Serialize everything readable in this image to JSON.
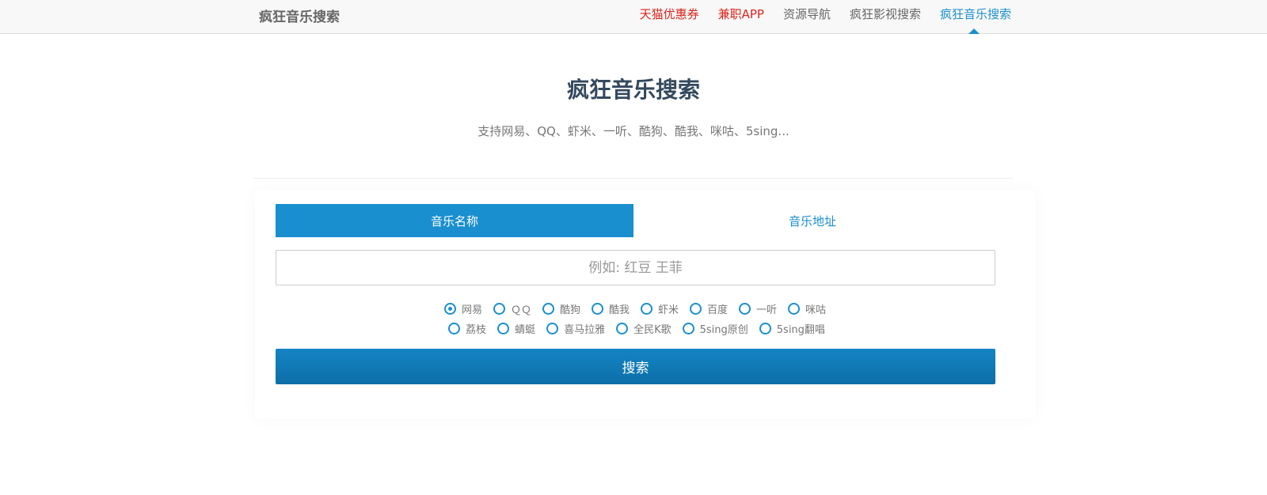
{
  "navbar": {
    "brand": "疯狂音乐搜索",
    "links": [
      {
        "label": "天猫优惠券",
        "state": "highlight"
      },
      {
        "label": "兼职APP",
        "state": "highlight"
      },
      {
        "label": "资源导航",
        "state": "normal"
      },
      {
        "label": "疯狂影视搜索",
        "state": "normal"
      },
      {
        "label": "疯狂音乐搜索",
        "state": "active"
      }
    ]
  },
  "hero": {
    "title": "疯狂音乐搜索",
    "subtitle": "支持网易、QQ、虾米、一听、酷狗、酷我、咪咕、5sing..."
  },
  "search": {
    "tabs": [
      {
        "label": "音乐名称",
        "selected": true
      },
      {
        "label": "音乐地址",
        "selected": false
      }
    ],
    "input_value": "",
    "input_placeholder": "例如: 红豆 王菲",
    "sources_row1": [
      "网易",
      "ＱＱ",
      "酷狗",
      "酷我",
      "虾米",
      "百度",
      "一听",
      "咪咕"
    ],
    "sources_row2": [
      "荔枝",
      "蜻蜓",
      "喜马拉雅",
      "全民K歌",
      "5sing原创",
      "5sing翻唱"
    ],
    "selected_source": "网易",
    "submit_label": "搜索"
  },
  "colors": {
    "accent": "#1a8fcf",
    "highlight_link": "#d9251c",
    "title": "#34495e",
    "button": "#0c6fa8"
  }
}
